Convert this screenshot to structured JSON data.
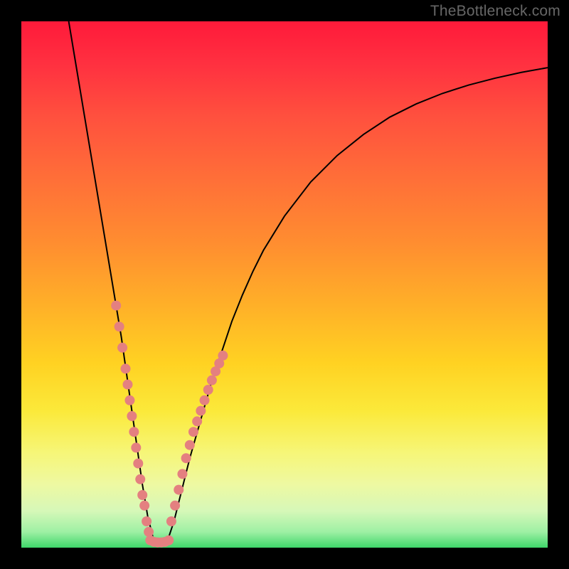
{
  "watermark": "TheBottleneck.com",
  "chart_data": {
    "type": "line",
    "title": "",
    "xlabel": "",
    "ylabel": "",
    "xlim": [
      0,
      100
    ],
    "ylim": [
      0,
      100
    ],
    "series": [
      {
        "name": "curve",
        "x": [
          9,
          10,
          11,
          12,
          13,
          14,
          15,
          16,
          17,
          18,
          19,
          20,
          21,
          22,
          23,
          24,
          25,
          26,
          27,
          28,
          29,
          30,
          32,
          34,
          36,
          38,
          40,
          42,
          44,
          46,
          50,
          55,
          60,
          65,
          70,
          75,
          80,
          85,
          90,
          95,
          100
        ],
        "y": [
          100,
          94,
          88,
          82,
          76,
          70,
          64,
          58,
          52,
          46,
          40,
          33,
          26,
          19,
          12,
          6,
          2,
          1,
          1,
          2,
          5,
          9,
          17,
          24,
          31,
          37,
          43,
          48,
          52.5,
          56.5,
          63,
          69.5,
          74.5,
          78.5,
          81.8,
          84.3,
          86.3,
          87.9,
          89.2,
          90.3,
          91.2
        ]
      }
    ],
    "scatter": [
      {
        "name": "left-dots",
        "x": [
          18.0,
          18.6,
          19.2,
          19.8,
          20.2,
          20.6,
          21.0,
          21.4,
          21.8,
          22.2,
          22.6,
          23.0,
          23.4,
          23.8,
          24.2
        ],
        "y": [
          46,
          42,
          38,
          34,
          31,
          28,
          25,
          22,
          19,
          16,
          13,
          10,
          8,
          5,
          3
        ]
      },
      {
        "name": "right-dots",
        "x": [
          28.5,
          29.2,
          29.9,
          30.6,
          31.3,
          32.0,
          32.7,
          33.4,
          34.1,
          34.8,
          35.5,
          36.2,
          36.9,
          37.6,
          38.3
        ],
        "y": [
          5,
          8,
          11,
          14,
          17,
          19.5,
          22,
          24,
          26,
          28,
          30,
          31.8,
          33.5,
          35,
          36.5
        ]
      },
      {
        "name": "bottom-dots",
        "x": [
          24.5,
          25.2,
          25.9,
          26.6,
          27.3,
          28.0
        ],
        "y": [
          1.4,
          1.1,
          1.0,
          1.0,
          1.1,
          1.4
        ]
      }
    ],
    "colors": {
      "curve": "#000000",
      "dots": "#e48080"
    }
  }
}
